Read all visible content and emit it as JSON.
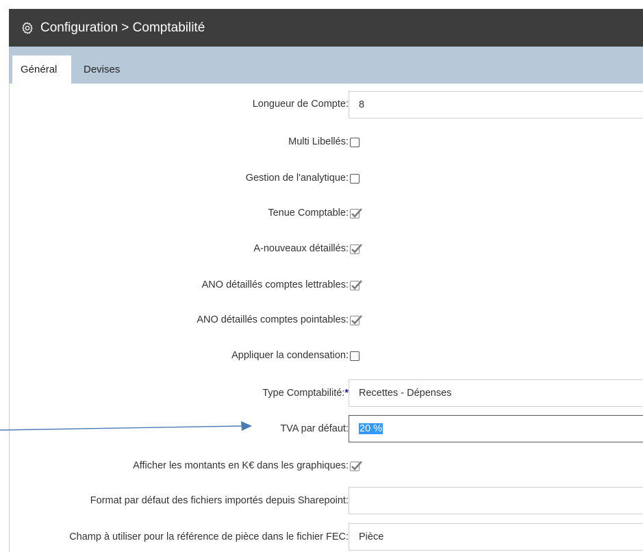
{
  "header": {
    "title": "Configuration > Comptabilité",
    "icon": "gear-icon"
  },
  "tabs": [
    {
      "label": "Général",
      "active": true
    },
    {
      "label": "Devises",
      "active": false
    }
  ],
  "form": {
    "longueur_compte": {
      "label": "Longueur de Compte:",
      "value": "8"
    },
    "multi_libelles": {
      "label": "Multi Libellés:",
      "checked": false
    },
    "gestion_analytique": {
      "label": "Gestion de l'analytique:",
      "checked": false
    },
    "tenue_comptable": {
      "label": "Tenue Comptable:",
      "checked": true
    },
    "a_nouveaux": {
      "label": "A-nouveaux détaillés:",
      "checked": true
    },
    "ano_lettrables": {
      "label": "ANO détaillés comptes lettrables:",
      "checked": true
    },
    "ano_pointables": {
      "label": "ANO détaillés comptes pointables:",
      "checked": true
    },
    "condensation": {
      "label": "Appliquer la condensation:",
      "checked": false
    },
    "type_compta": {
      "label": "Type Comptabilité:",
      "required_mark": "*",
      "value": "Recettes - Dépenses"
    },
    "tva_defaut": {
      "label": "TVA par défaut:",
      "value": "20 %"
    },
    "montants_ke": {
      "label": "Afficher les montants en K€ dans les graphiques:",
      "checked": true
    },
    "format_sharepoint": {
      "label": "Format par défaut des fichiers importés depuis Sharepoint:",
      "value": ""
    },
    "champ_fec": {
      "label": "Champ à utiliser pour la référence de pièce dans le fichier FEC:",
      "value": "Pièce"
    }
  },
  "colors": {
    "titlebar": "#3d3d3d",
    "tabbar": "#b7c9d8",
    "arrow": "#4a7ab5",
    "selection": "#3399ff"
  }
}
